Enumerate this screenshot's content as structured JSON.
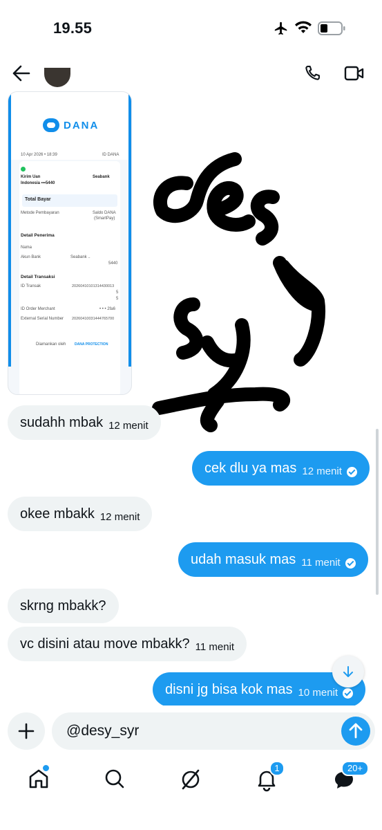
{
  "status_bar": {
    "time": "19.55"
  },
  "receipt": {
    "brand": "DANA",
    "date": "10 Apr 2026 • 18:39",
    "id_label": "ID DANA",
    "kirim_line1": "Kirim Uan",
    "kirim_line2": "Indonesia •••5440",
    "bank": "Seabank",
    "total_label": "Total Bayar",
    "method_label": "Metode Pembayaran",
    "method_value": "Saldo DANA",
    "method_value2": "(SmartPay)",
    "recipient_title": "Detail Penerima",
    "name_label": "Nama",
    "bank_acct_label": "Akun Bank",
    "bank_acct_value": "Seabank ..",
    "bank_acct_num": "5440",
    "txn_title": "Detail Transaksi",
    "txn_id_label": "ID Transak",
    "txn_id_value": "20260410101314430013",
    "txn_id_cont1": "5",
    "txn_id_cont2": "5",
    "merchant_label": "ID Order Merchant",
    "merchant_value": "• • • 2fa6",
    "serial_label": "External Serial Number",
    "serial_value": "20260410031444765700",
    "footer_secured": "Diamankan oleh",
    "footer_brand": "DANA PROTECTION"
  },
  "sticker": {
    "line1": "desy",
    "line2": "syr"
  },
  "messages": [
    {
      "dir": "in",
      "text": "sudahh mbak",
      "time": "12 menit"
    },
    {
      "dir": "out",
      "text": "cek dlu ya mas",
      "time": "12 menit"
    },
    {
      "dir": "in",
      "text": "okee mbakk",
      "time": "12 menit"
    },
    {
      "dir": "out",
      "text": "udah masuk mas",
      "time": "11 menit"
    },
    {
      "dir": "in",
      "text": "skrng mbakk?",
      "time": ""
    },
    {
      "dir": "in",
      "text": "vc disini atau move mbakk?",
      "time": "11 menit"
    },
    {
      "dir": "out",
      "text": "disni jg bisa kok mas",
      "time": "10 menit"
    }
  ],
  "composer": {
    "value": "@desy_syr"
  },
  "nav": {
    "notifications_badge": "1",
    "messages_badge": "20+"
  },
  "colors": {
    "accent": "#1d9bf0",
    "incoming": "#eff3f4",
    "dana": "#118eea"
  }
}
